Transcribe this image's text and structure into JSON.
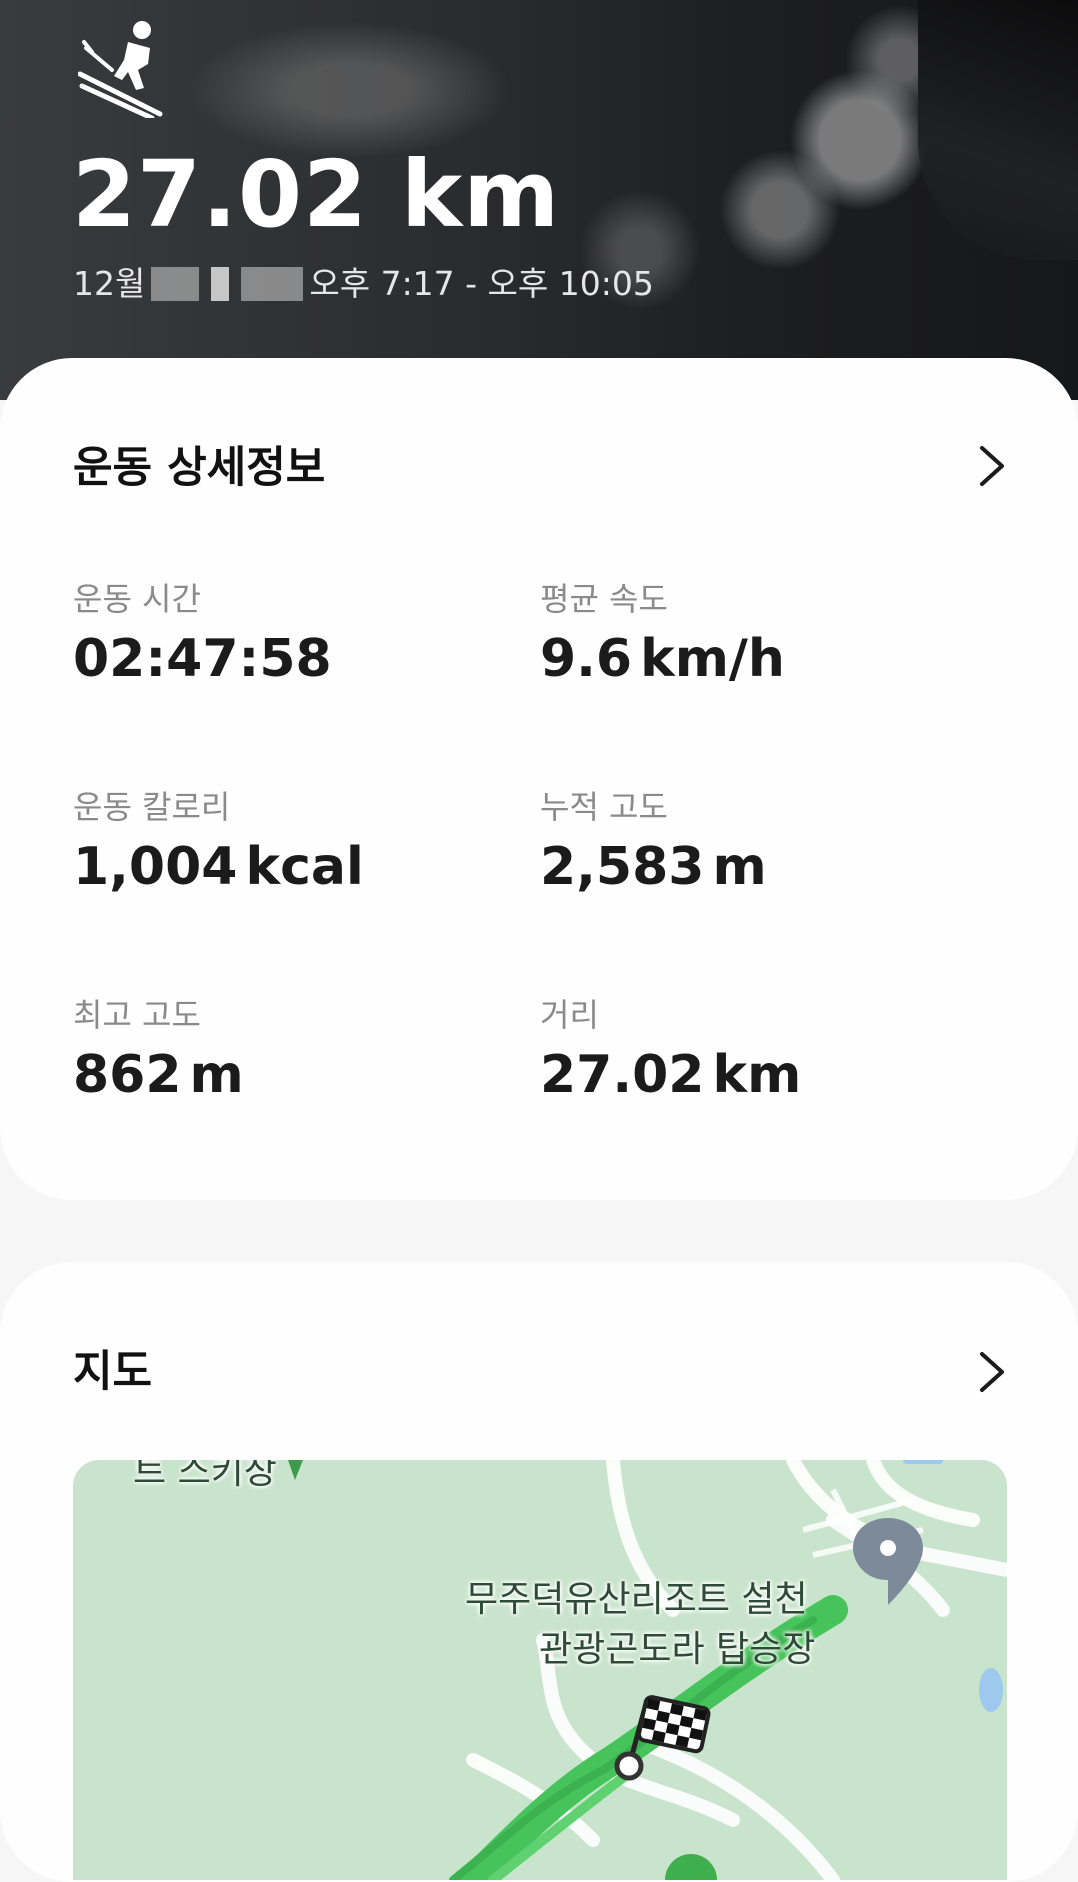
{
  "hero": {
    "activity_icon": "skiing-icon",
    "distance": "27.02 km",
    "date_month": "12월",
    "time_range": "오후 7:17 - 오후 10:05"
  },
  "details": {
    "title": "운동 상세정보",
    "chevron_icon": "chevron-right-icon",
    "stats": [
      {
        "label": "운동 시간",
        "value": "02:47:58",
        "unit": ""
      },
      {
        "label": "평균 속도",
        "value": "9.6",
        "unit": "km/h"
      },
      {
        "label": "운동 칼로리",
        "value": "1,004",
        "unit": "kcal"
      },
      {
        "label": "누적 고도",
        "value": "2,583",
        "unit": "m"
      },
      {
        "label": "최고 고도",
        "value": "862",
        "unit": "m"
      },
      {
        "label": "거리",
        "value": "27.02",
        "unit": "km"
      }
    ]
  },
  "map": {
    "title": "지도",
    "chevron_icon": "chevron-right-icon",
    "place_line1": "무주덕유산리조트 설천",
    "place_line2": "관광곤도라 탑승장",
    "top_label": "트 스키장",
    "colors": {
      "route": "#46c35a",
      "map_bg": "#c9e4cc",
      "pin": "#7c8a99"
    }
  }
}
